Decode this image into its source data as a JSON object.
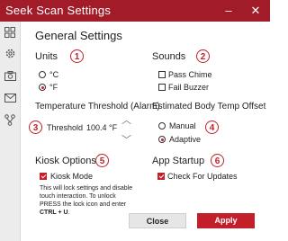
{
  "window": {
    "title": "Seek Scan Settings",
    "min": "–",
    "close": "✕"
  },
  "sidebar": {
    "icons": [
      "grid-icon",
      "gear-icon",
      "camera-icon",
      "mail-icon",
      "network-icon"
    ]
  },
  "general": {
    "title": "General Settings"
  },
  "units": {
    "heading": "Units",
    "badge": "1",
    "celsius": "°C",
    "fahrenheit": "°F",
    "selected": "°F"
  },
  "sounds": {
    "heading": "Sounds",
    "badge": "2",
    "pass": "Pass Chime",
    "fail": "Fail Buzzer",
    "pass_checked": false,
    "fail_checked": false
  },
  "threshold": {
    "heading": "Temperature Threshold (Alarm)",
    "badge": "3",
    "label": "Threshold",
    "value": "100.4 °F",
    "up": "︿",
    "down": "﹀"
  },
  "offset": {
    "heading": "Estimated Body Temp Offset",
    "badge": "4",
    "manual": "Manual",
    "adaptive": "Adaptive",
    "selected": "Adaptive"
  },
  "kiosk": {
    "heading": "Kiosk Options",
    "badge": "5",
    "label": "Kiosk Mode",
    "checked": true,
    "note_1": "This will lock settings and disable touch interaction. To unlock PRESS the lock icon and enter ",
    "note_keys": "CTRL + U",
    "note_end": "."
  },
  "startup": {
    "heading": "App Startup",
    "badge": "6",
    "label": "Check For Updates",
    "checked": true
  },
  "buttons": {
    "close": "Close",
    "apply": "Apply"
  },
  "colors": {
    "accent": "#c0222a",
    "titlebar": "#a11b29"
  }
}
